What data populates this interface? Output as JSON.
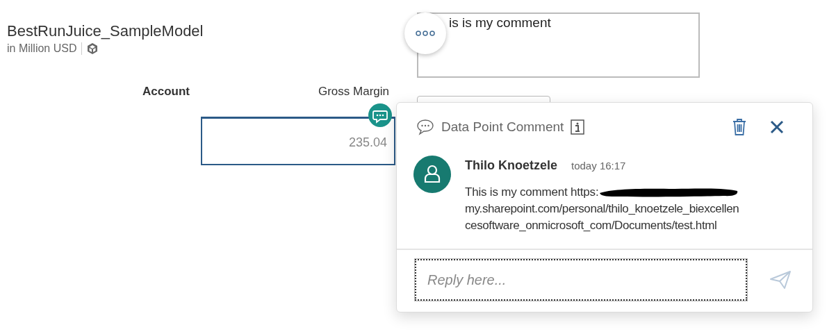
{
  "model": {
    "title": "BestRunJuice_SampleModel",
    "subtitle": "in Million USD"
  },
  "table": {
    "columns": [
      "Account",
      "Gross Margin"
    ],
    "cell": "235.04"
  },
  "comment_box": {
    "value": "is is my comment"
  },
  "popup": {
    "title": "Data Point Comment",
    "comment": {
      "author": "Thilo Knoetzele",
      "time": "today 16:17",
      "text_start": "This is my comment https:",
      "lines": [
        "my.sharepoint.com/personal/thilo_knoetzele_biexcellen",
        "cesoftware_onmicrosoft_com/Documents/test.html"
      ]
    },
    "reply": {
      "placeholder": "Reply here..."
    }
  }
}
